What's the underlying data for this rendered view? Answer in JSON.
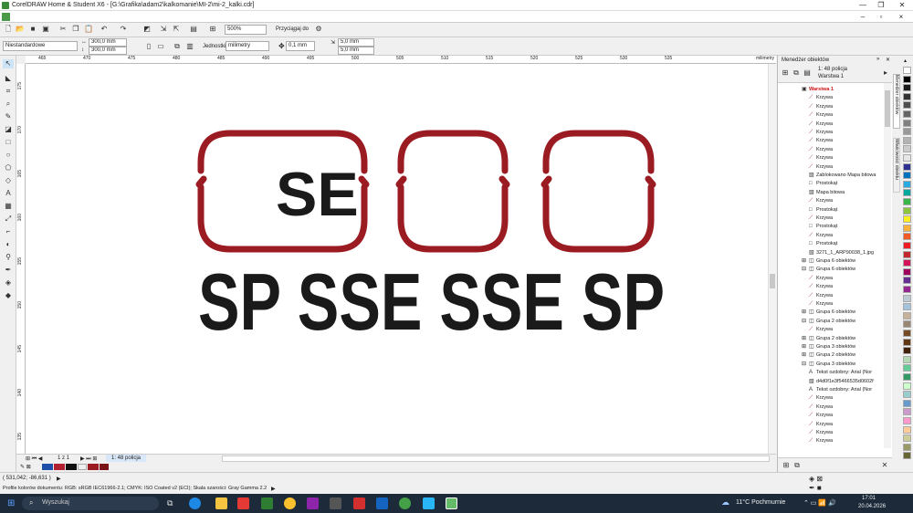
{
  "window": {
    "title": "CorelDRAW Home & Student X6 - [G:\\Grafika\\adam2\\kalkomanie\\MI-2\\mi-2_kalki.cdr]",
    "min": "—",
    "max": "❐",
    "close": "✕"
  },
  "toolbar": {
    "zoom": "500%",
    "snap": "Przyciągaj do"
  },
  "propbar": {
    "preset": "Niestandardowe",
    "width": "300,0 mm",
    "height": "300,0 mm",
    "units_label": "Jednostki:",
    "units": "milimetry",
    "nudge": "0,1 mm",
    "dup_x": "5,0 mm",
    "dup_y": "5,0 mm"
  },
  "ruler": {
    "top": [
      "465",
      "470",
      "475",
      "480",
      "485",
      "490",
      "495",
      "500",
      "505",
      "510",
      "515",
      "520",
      "525",
      "530",
      "535"
    ],
    "unit": "milimetry",
    "left": [
      "175",
      "170",
      "165",
      "160",
      "155",
      "150",
      "145",
      "140",
      "135"
    ]
  },
  "artwork": {
    "plates": [
      "SE",
      "",
      ""
    ],
    "line2": "SP SSE SSE SP",
    "accent": "#9b1b22"
  },
  "pages": {
    "counter": "1 z 1",
    "tab": "1: 48 policja"
  },
  "status": {
    "coords": "( 531,042; -86,631 )",
    "profile": "Profile kolorów dokumentu: RGB: sRGB IEC61966-2.1; CMYK: ISO Coated v2 (ECI); Skala szarości: Gray Gamma 2.2"
  },
  "docker": {
    "title": "Menedżer obiektów",
    "page": "1: 48 policja",
    "layer_top": "Warstwa 1",
    "side_tab1": "Menedżer obiektów",
    "side_tab2": "Właściwości obiektu",
    "tree": [
      {
        "lvl": 0,
        "icon": "layer",
        "label": "Warstwa 1",
        "red": true
      },
      {
        "lvl": 1,
        "icon": "curve",
        "label": "Krzywa"
      },
      {
        "lvl": 1,
        "icon": "curve",
        "label": "Krzywa"
      },
      {
        "lvl": 1,
        "icon": "curve",
        "label": "Krzywa"
      },
      {
        "lvl": 1,
        "icon": "curve",
        "label": "Krzywa"
      },
      {
        "lvl": 1,
        "icon": "curve",
        "label": "Krzywa"
      },
      {
        "lvl": 1,
        "icon": "curve",
        "label": "Krzywa"
      },
      {
        "lvl": 1,
        "icon": "curve",
        "label": "Krzywa"
      },
      {
        "lvl": 1,
        "icon": "curve",
        "label": "Krzywa"
      },
      {
        "lvl": 1,
        "icon": "curve",
        "label": "Krzywa"
      },
      {
        "lvl": 1,
        "icon": "bitmap",
        "label": "Zablokowano Mapa bitowa"
      },
      {
        "lvl": 1,
        "icon": "rect",
        "label": "Prostokąt"
      },
      {
        "lvl": 1,
        "icon": "bitmap",
        "label": "Mapa bitowa"
      },
      {
        "lvl": 1,
        "icon": "curve",
        "label": "Krzywa"
      },
      {
        "lvl": 1,
        "icon": "rect",
        "label": "Prostokąt"
      },
      {
        "lvl": 1,
        "icon": "curve",
        "label": "Krzywa"
      },
      {
        "lvl": 1,
        "icon": "rect",
        "label": "Prostokąt"
      },
      {
        "lvl": 1,
        "icon": "curve",
        "label": "Krzywa"
      },
      {
        "lvl": 1,
        "icon": "rect",
        "label": "Prostokąt"
      },
      {
        "lvl": 1,
        "icon": "bitmap",
        "label": "3271_1_ARP90038_1.jpg"
      },
      {
        "lvl": 0,
        "icon": "group",
        "label": "Grupa 6 obiektów",
        "exp": "⊞"
      },
      {
        "lvl": 0,
        "icon": "group",
        "label": "Grupa 6 obiektów",
        "exp": "⊟"
      },
      {
        "lvl": 1,
        "icon": "curve",
        "label": "Krzywa"
      },
      {
        "lvl": 1,
        "icon": "curve",
        "label": "Krzywa"
      },
      {
        "lvl": 1,
        "icon": "curve",
        "label": "Krzywa"
      },
      {
        "lvl": 1,
        "icon": "curve",
        "label": "Krzywa"
      },
      {
        "lvl": 0,
        "icon": "group",
        "label": "Grupa 6 obiektów",
        "exp": "⊞"
      },
      {
        "lvl": 0,
        "icon": "group",
        "label": "Grupa 2 obiektów",
        "exp": "⊟"
      },
      {
        "lvl": 1,
        "icon": "curve",
        "label": "Krzywa"
      },
      {
        "lvl": 0,
        "icon": "group",
        "label": "Grupa 2 obiektów",
        "exp": "⊞"
      },
      {
        "lvl": 0,
        "icon": "group",
        "label": "Grupa 3 obiektów",
        "exp": "⊞"
      },
      {
        "lvl": 0,
        "icon": "group",
        "label": "Grupa 2 obiektów",
        "exp": "⊞"
      },
      {
        "lvl": 0,
        "icon": "group",
        "label": "Grupa 3 obiektów",
        "exp": "⊟"
      },
      {
        "lvl": 1,
        "icon": "text",
        "label": "Tekst ozdobny: Arial (Nor"
      },
      {
        "lvl": 1,
        "icon": "bitmap",
        "label": "d4d0f1e3f5466535d0602f"
      },
      {
        "lvl": 1,
        "icon": "text",
        "label": "Tekst ozdobny: Arial (Nor"
      },
      {
        "lvl": 1,
        "icon": "curve",
        "label": "Krzywa"
      },
      {
        "lvl": 1,
        "icon": "curve",
        "label": "Krzywa"
      },
      {
        "lvl": 1,
        "icon": "curve",
        "label": "Krzywa"
      },
      {
        "lvl": 1,
        "icon": "curve",
        "label": "Krzywa"
      },
      {
        "lvl": 1,
        "icon": "curve",
        "label": "Krzywa"
      },
      {
        "lvl": 1,
        "icon": "curve",
        "label": "Krzywa"
      }
    ]
  },
  "palette": [
    "#ffffff",
    "#000000",
    "#1a1a1a",
    "#333333",
    "#4d4d4d",
    "#666666",
    "#808080",
    "#999999",
    "#b3b3b3",
    "#cccccc",
    "#e6e6e6",
    "#2e3192",
    "#0071bc",
    "#29abe2",
    "#00a99d",
    "#39b54a",
    "#8cc63f",
    "#fcee21",
    "#fbb03b",
    "#f15a24",
    "#ed1c24",
    "#c1272d",
    "#d4145a",
    "#9e005d",
    "#662d91",
    "#93278f",
    "#bdccd4",
    "#a3c4dc",
    "#c7b299",
    "#998675",
    "#754c24",
    "#603813",
    "#42210b",
    "#b3d9b3",
    "#66cc99",
    "#339966",
    "#ccffcc",
    "#99cccc",
    "#6699cc",
    "#cc99cc",
    "#ff99cc",
    "#ffcc99",
    "#cccc99",
    "#999966",
    "#666633"
  ],
  "taskbar": {
    "search": "Wyszukaj",
    "weather": "11°C  Pochmurnie",
    "time": "17:01",
    "date": "20.04.2026"
  }
}
